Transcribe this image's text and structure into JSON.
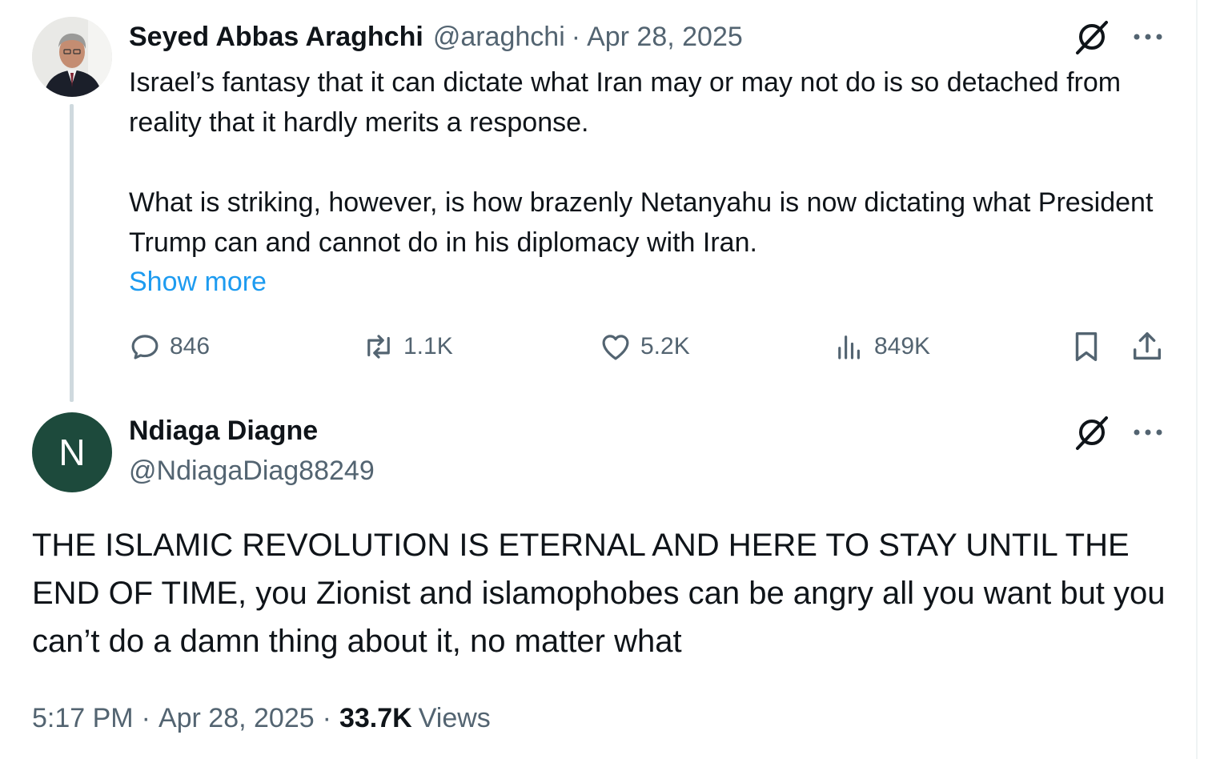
{
  "parent_tweet": {
    "author_name": "Seyed Abbas Araghchi",
    "handle": "@araghchi",
    "separator": "·",
    "date": "Apr 28, 2025",
    "paragraphs": [
      "Israel’s fantasy that it can dictate what Iran may or may not do is so detached from reality that it hardly merits a response.",
      "What is striking, however, is how brazenly Netanyahu is now dictating what President Trump can and cannot do in his diplomacy with Iran."
    ],
    "show_more": "Show more",
    "stats": {
      "replies": "846",
      "reposts": "1.1K",
      "likes": "5.2K",
      "views": "849K"
    }
  },
  "reply_tweet": {
    "avatar_initial": "N",
    "author_name": "Ndiaga Diagne",
    "handle": "@NdiagaDiag88249",
    "text": "THE ISLAMIC REVOLUTION IS ETERNAL AND HERE TO STAY UNTIL THE END OF TIME, you Zionist and islamophobes can be angry all you want but you can’t do a damn thing about it, no matter what",
    "time": "5:17 PM",
    "separator": "·",
    "date": "Apr 28, 2025",
    "views_count": "33.7K",
    "views_label": "Views"
  },
  "colors": {
    "text_primary": "#0f1419",
    "text_secondary": "#536471",
    "link": "#1d9bf0",
    "avatar_reply_bg": "#1d4a3c",
    "thread_line": "#cfd9de"
  },
  "icons": [
    "grok-icon",
    "more-icon",
    "reply-icon",
    "repost-icon",
    "like-icon",
    "views-icon",
    "bookmark-icon",
    "share-icon"
  ]
}
